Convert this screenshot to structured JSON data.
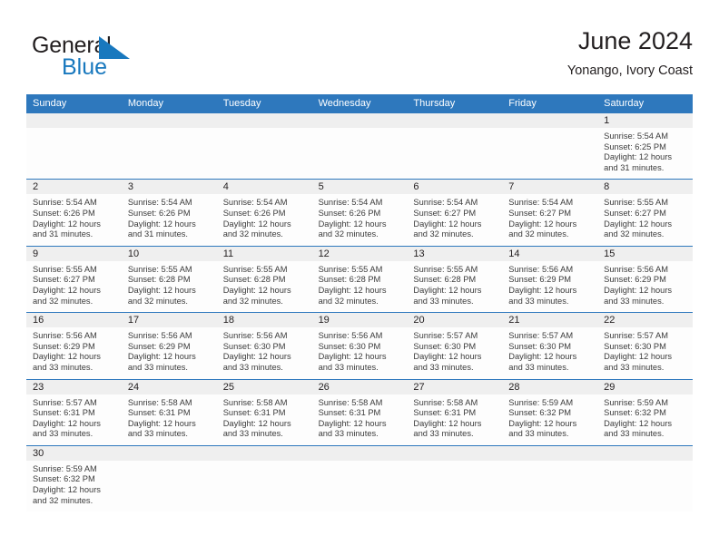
{
  "brand": {
    "name_part1": "General",
    "name_part2": "Blue",
    "triangle_icon": "blue-triangle-icon",
    "accent_color": "#1878be"
  },
  "header": {
    "title": "June 2024",
    "subtitle": "Yonango, Ivory Coast"
  },
  "theme": {
    "header_bar_color": "#2e78bd",
    "daynum_band_color": "#efefef",
    "row_separator_color": "#2e78bd",
    "text_color": "#231f20"
  },
  "calendar": {
    "weekdays": [
      "Sunday",
      "Monday",
      "Tuesday",
      "Wednesday",
      "Thursday",
      "Friday",
      "Saturday"
    ],
    "labels": {
      "sunrise": "Sunrise:",
      "sunset": "Sunset:",
      "daylight": "Daylight:"
    },
    "weeks": [
      [
        {
          "empty": true
        },
        {
          "empty": true
        },
        {
          "empty": true
        },
        {
          "empty": true
        },
        {
          "empty": true
        },
        {
          "empty": true
        },
        {
          "day": "1",
          "sunrise": "Sunrise: 5:54 AM",
          "sunset": "Sunset: 6:25 PM",
          "daylight1": "Daylight: 12 hours",
          "daylight2": "and 31 minutes."
        }
      ],
      [
        {
          "day": "2",
          "sunrise": "Sunrise: 5:54 AM",
          "sunset": "Sunset: 6:26 PM",
          "daylight1": "Daylight: 12 hours",
          "daylight2": "and 31 minutes."
        },
        {
          "day": "3",
          "sunrise": "Sunrise: 5:54 AM",
          "sunset": "Sunset: 6:26 PM",
          "daylight1": "Daylight: 12 hours",
          "daylight2": "and 31 minutes."
        },
        {
          "day": "4",
          "sunrise": "Sunrise: 5:54 AM",
          "sunset": "Sunset: 6:26 PM",
          "daylight1": "Daylight: 12 hours",
          "daylight2": "and 32 minutes."
        },
        {
          "day": "5",
          "sunrise": "Sunrise: 5:54 AM",
          "sunset": "Sunset: 6:26 PM",
          "daylight1": "Daylight: 12 hours",
          "daylight2": "and 32 minutes."
        },
        {
          "day": "6",
          "sunrise": "Sunrise: 5:54 AM",
          "sunset": "Sunset: 6:27 PM",
          "daylight1": "Daylight: 12 hours",
          "daylight2": "and 32 minutes."
        },
        {
          "day": "7",
          "sunrise": "Sunrise: 5:54 AM",
          "sunset": "Sunset: 6:27 PM",
          "daylight1": "Daylight: 12 hours",
          "daylight2": "and 32 minutes."
        },
        {
          "day": "8",
          "sunrise": "Sunrise: 5:55 AM",
          "sunset": "Sunset: 6:27 PM",
          "daylight1": "Daylight: 12 hours",
          "daylight2": "and 32 minutes."
        }
      ],
      [
        {
          "day": "9",
          "sunrise": "Sunrise: 5:55 AM",
          "sunset": "Sunset: 6:27 PM",
          "daylight1": "Daylight: 12 hours",
          "daylight2": "and 32 minutes."
        },
        {
          "day": "10",
          "sunrise": "Sunrise: 5:55 AM",
          "sunset": "Sunset: 6:28 PM",
          "daylight1": "Daylight: 12 hours",
          "daylight2": "and 32 minutes."
        },
        {
          "day": "11",
          "sunrise": "Sunrise: 5:55 AM",
          "sunset": "Sunset: 6:28 PM",
          "daylight1": "Daylight: 12 hours",
          "daylight2": "and 32 minutes."
        },
        {
          "day": "12",
          "sunrise": "Sunrise: 5:55 AM",
          "sunset": "Sunset: 6:28 PM",
          "daylight1": "Daylight: 12 hours",
          "daylight2": "and 32 minutes."
        },
        {
          "day": "13",
          "sunrise": "Sunrise: 5:55 AM",
          "sunset": "Sunset: 6:28 PM",
          "daylight1": "Daylight: 12 hours",
          "daylight2": "and 33 minutes."
        },
        {
          "day": "14",
          "sunrise": "Sunrise: 5:56 AM",
          "sunset": "Sunset: 6:29 PM",
          "daylight1": "Daylight: 12 hours",
          "daylight2": "and 33 minutes."
        },
        {
          "day": "15",
          "sunrise": "Sunrise: 5:56 AM",
          "sunset": "Sunset: 6:29 PM",
          "daylight1": "Daylight: 12 hours",
          "daylight2": "and 33 minutes."
        }
      ],
      [
        {
          "day": "16",
          "sunrise": "Sunrise: 5:56 AM",
          "sunset": "Sunset: 6:29 PM",
          "daylight1": "Daylight: 12 hours",
          "daylight2": "and 33 minutes."
        },
        {
          "day": "17",
          "sunrise": "Sunrise: 5:56 AM",
          "sunset": "Sunset: 6:29 PM",
          "daylight1": "Daylight: 12 hours",
          "daylight2": "and 33 minutes."
        },
        {
          "day": "18",
          "sunrise": "Sunrise: 5:56 AM",
          "sunset": "Sunset: 6:30 PM",
          "daylight1": "Daylight: 12 hours",
          "daylight2": "and 33 minutes."
        },
        {
          "day": "19",
          "sunrise": "Sunrise: 5:56 AM",
          "sunset": "Sunset: 6:30 PM",
          "daylight1": "Daylight: 12 hours",
          "daylight2": "and 33 minutes."
        },
        {
          "day": "20",
          "sunrise": "Sunrise: 5:57 AM",
          "sunset": "Sunset: 6:30 PM",
          "daylight1": "Daylight: 12 hours",
          "daylight2": "and 33 minutes."
        },
        {
          "day": "21",
          "sunrise": "Sunrise: 5:57 AM",
          "sunset": "Sunset: 6:30 PM",
          "daylight1": "Daylight: 12 hours",
          "daylight2": "and 33 minutes."
        },
        {
          "day": "22",
          "sunrise": "Sunrise: 5:57 AM",
          "sunset": "Sunset: 6:30 PM",
          "daylight1": "Daylight: 12 hours",
          "daylight2": "and 33 minutes."
        }
      ],
      [
        {
          "day": "23",
          "sunrise": "Sunrise: 5:57 AM",
          "sunset": "Sunset: 6:31 PM",
          "daylight1": "Daylight: 12 hours",
          "daylight2": "and 33 minutes."
        },
        {
          "day": "24",
          "sunrise": "Sunrise: 5:58 AM",
          "sunset": "Sunset: 6:31 PM",
          "daylight1": "Daylight: 12 hours",
          "daylight2": "and 33 minutes."
        },
        {
          "day": "25",
          "sunrise": "Sunrise: 5:58 AM",
          "sunset": "Sunset: 6:31 PM",
          "daylight1": "Daylight: 12 hours",
          "daylight2": "and 33 minutes."
        },
        {
          "day": "26",
          "sunrise": "Sunrise: 5:58 AM",
          "sunset": "Sunset: 6:31 PM",
          "daylight1": "Daylight: 12 hours",
          "daylight2": "and 33 minutes."
        },
        {
          "day": "27",
          "sunrise": "Sunrise: 5:58 AM",
          "sunset": "Sunset: 6:31 PM",
          "daylight1": "Daylight: 12 hours",
          "daylight2": "and 33 minutes."
        },
        {
          "day": "28",
          "sunrise": "Sunrise: 5:59 AM",
          "sunset": "Sunset: 6:32 PM",
          "daylight1": "Daylight: 12 hours",
          "daylight2": "and 33 minutes."
        },
        {
          "day": "29",
          "sunrise": "Sunrise: 5:59 AM",
          "sunset": "Sunset: 6:32 PM",
          "daylight1": "Daylight: 12 hours",
          "daylight2": "and 33 minutes."
        }
      ],
      [
        {
          "day": "30",
          "sunrise": "Sunrise: 5:59 AM",
          "sunset": "Sunset: 6:32 PM",
          "daylight1": "Daylight: 12 hours",
          "daylight2": "and 32 minutes."
        },
        {
          "empty": true
        },
        {
          "empty": true
        },
        {
          "empty": true
        },
        {
          "empty": true
        },
        {
          "empty": true
        },
        {
          "empty": true
        }
      ]
    ]
  }
}
